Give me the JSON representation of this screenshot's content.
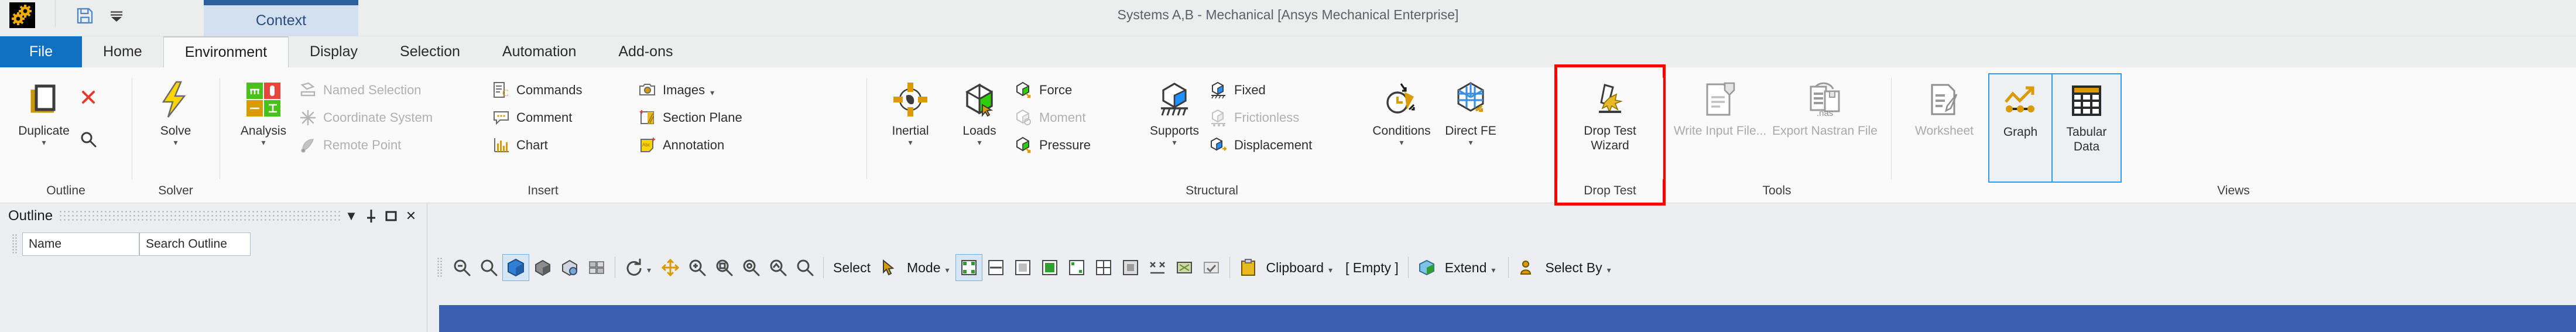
{
  "window": {
    "title": "Systems A,B - Mechanical [Ansys Mechanical Enterprise]",
    "app_icon": "ansys-gears-icon"
  },
  "quick_access": {
    "items": [
      {
        "name": "save-icon",
        "glyph": "save"
      },
      {
        "name": "customize-qat-dropdown-icon",
        "glyph": "chevron-down"
      }
    ]
  },
  "context_tab": {
    "label": "Context"
  },
  "tabs": [
    {
      "label": "File",
      "kind": "file"
    },
    {
      "label": "Home",
      "kind": "normal"
    },
    {
      "label": "Environment",
      "kind": "active"
    },
    {
      "label": "Display",
      "kind": "normal"
    },
    {
      "label": "Selection",
      "kind": "normal"
    },
    {
      "label": "Automation",
      "kind": "normal"
    },
    {
      "label": "Add-ons",
      "kind": "normal"
    }
  ],
  "ribbon": {
    "groups": [
      {
        "title": "Outline",
        "big_buttons": [
          {
            "label": "Duplicate",
            "icon": "duplicate-icon",
            "caret": true,
            "dim": false
          }
        ],
        "small_buttons": [
          {
            "label": "",
            "icon": "delete-x-icon",
            "dim": false
          },
          {
            "label": "",
            "icon": "find-magnifier-icon",
            "dim": false
          }
        ]
      },
      {
        "title": "Solver",
        "big_buttons": [
          {
            "label": "Solve",
            "icon": "solve-lightning-icon",
            "caret": true,
            "dim": false
          }
        ],
        "small_buttons": []
      },
      {
        "title": "Insert",
        "big_buttons": [
          {
            "label": "Analysis",
            "icon": "analysis-quad-icon",
            "caret": true,
            "dim": false
          }
        ],
        "small_buttons": [
          {
            "label": "Named Selection",
            "icon": "named-selection-icon",
            "dim": true
          },
          {
            "label": "Coordinate System",
            "icon": "coordinate-system-icon",
            "dim": true
          },
          {
            "label": "Remote Point",
            "icon": "remote-point-icon",
            "dim": true
          },
          {
            "label": "Commands",
            "icon": "commands-icon",
            "dim": false
          },
          {
            "label": "Comment",
            "icon": "comment-icon",
            "dim": false
          },
          {
            "label": "Chart",
            "icon": "chart-icon",
            "dim": false
          },
          {
            "label": "Images",
            "icon": "images-icon",
            "dim": false,
            "caret": true
          },
          {
            "label": "Section Plane",
            "icon": "section-plane-icon",
            "dim": false
          },
          {
            "label": "Annotation",
            "icon": "annotation-icon",
            "dim": false
          }
        ]
      },
      {
        "title": "Structural",
        "big_buttons": [
          {
            "label": "Inertial",
            "icon": "inertial-icon",
            "caret": true,
            "dim": false
          },
          {
            "label": "Loads",
            "icon": "loads-icon",
            "caret": true,
            "dim": false
          },
          {
            "label": "Supports",
            "icon": "supports-icon",
            "caret": true,
            "dim": false
          },
          {
            "label": "Conditions",
            "icon": "conditions-icon",
            "caret": true,
            "dim": false
          },
          {
            "label": "Direct FE",
            "icon": "direct-fe-icon",
            "caret": true,
            "dim": false
          }
        ],
        "small_buttons": [
          {
            "label": "Force",
            "icon": "force-icon",
            "dim": false
          },
          {
            "label": "Moment",
            "icon": "moment-icon",
            "dim": true
          },
          {
            "label": "Pressure",
            "icon": "pressure-icon",
            "dim": false
          },
          {
            "label": "Fixed",
            "icon": "fixed-support-icon",
            "dim": false
          },
          {
            "label": "Frictionless",
            "icon": "frictionless-support-icon",
            "dim": true
          },
          {
            "label": "Displacement",
            "icon": "displacement-icon",
            "dim": false
          }
        ]
      },
      {
        "title": "Drop Test",
        "highlighted": true,
        "big_buttons": [
          {
            "label": "Drop Test Wizard",
            "icon": "drop-test-wizard-icon",
            "caret": false,
            "dim": false
          }
        ],
        "small_buttons": []
      },
      {
        "title": "Tools",
        "big_buttons": [
          {
            "label": "Write Input File...",
            "icon": "write-input-file-icon",
            "caret": false,
            "dim": true
          },
          {
            "label": "Export Nastran File",
            "icon": "export-nastran-file-icon",
            "caret": false,
            "dim": true
          }
        ],
        "small_buttons": []
      },
      {
        "title": "Views",
        "big_buttons": [
          {
            "label": "Worksheet",
            "icon": "worksheet-icon",
            "caret": false,
            "dim": true
          },
          {
            "label": "Graph",
            "icon": "graph-icon",
            "caret": false,
            "dim": false,
            "selected": true
          },
          {
            "label": "Tabular Data",
            "icon": "tabular-data-icon",
            "caret": false,
            "dim": false,
            "selected": true
          }
        ],
        "small_buttons": []
      }
    ]
  },
  "outline_panel": {
    "title": "Outline",
    "header_buttons": [
      {
        "name": "panel-menu-chevron-icon",
        "glyph": "▼"
      },
      {
        "name": "pin-icon",
        "glyph": "⊥"
      },
      {
        "name": "maximize-icon",
        "glyph": "❐"
      },
      {
        "name": "close-icon",
        "glyph": "✕"
      }
    ],
    "columns": [
      "Name",
      "Search Outline"
    ]
  },
  "graphics_toolbar": {
    "left_tools": [
      {
        "name": "zoom-out-icon",
        "glyph": "zoom-out"
      },
      {
        "name": "zoom-in-icon",
        "glyph": "zoom-in"
      },
      {
        "name": "box-select-icon",
        "glyph": "cube-blue",
        "active": true
      },
      {
        "name": "wireframe-icon",
        "glyph": "cube-shaded"
      },
      {
        "name": "show-mesh-icon",
        "glyph": "mesh"
      },
      {
        "name": "random-colors-icon",
        "glyph": "colors"
      },
      {
        "name": "rotate-icon",
        "glyph": "rotate",
        "caret": true
      },
      {
        "name": "pan-icon",
        "glyph": "pan"
      },
      {
        "name": "zoom-region-icon",
        "glyph": "zoom-region"
      },
      {
        "name": "zoom-fit-icon",
        "glyph": "zoom-fit"
      },
      {
        "name": "zoom-to-fit-icon",
        "glyph": "zoom-to-fit"
      },
      {
        "name": "magnifier-icon",
        "glyph": "magnifier"
      },
      {
        "name": "search-icon",
        "glyph": "search"
      }
    ],
    "select_label": "Select",
    "mode_label": "Mode",
    "selection_filters": [
      {
        "name": "select-vertices-icon"
      },
      {
        "name": "select-edges-icon"
      },
      {
        "name": "select-faces-icon"
      },
      {
        "name": "select-bodies-icon"
      },
      {
        "name": "select-nodes-icon"
      },
      {
        "name": "select-elements-icon"
      },
      {
        "name": "select-element-faces-icon"
      },
      {
        "name": "extend-to-adjacent-icon"
      },
      {
        "name": "extend-to-limits-icon"
      },
      {
        "name": "select-all-icon"
      }
    ],
    "right_items": [
      {
        "name": "clipboard-button",
        "label": "Clipboard",
        "icon": "clipboard-icon",
        "caret": true
      },
      {
        "name": "clipboard-empty-label",
        "label": "[ Empty ]",
        "icon": ""
      },
      {
        "name": "extend-button",
        "label": "Extend",
        "icon": "extend-icon",
        "caret": true
      },
      {
        "name": "select-by-button",
        "label": "Select By",
        "icon": "select-by-icon",
        "caret": true
      }
    ]
  }
}
